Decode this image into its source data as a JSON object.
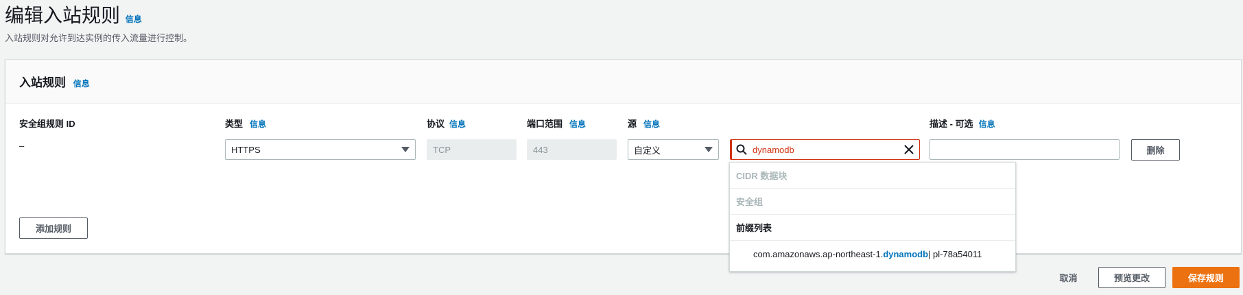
{
  "page": {
    "title": "编辑入站规则",
    "title_info": "信息",
    "subtitle": "入站规则对允许到达实例的传入流量进行控制。"
  },
  "panel": {
    "title": "入站规则",
    "title_info": "信息",
    "columns": {
      "rule_id": "安全组规则 ID",
      "type": "类型",
      "protocol": "协议",
      "port_range": "端口范围",
      "source": "源",
      "description": "描述 - 可选",
      "info": "信息"
    },
    "rule": {
      "rule_id": "–",
      "type": "HTTPS",
      "protocol": "TCP",
      "port_range": "443",
      "source_mode": "自定义",
      "search_value": "dynamodb",
      "description": ""
    },
    "delete_label": "删除",
    "add_rule_label": "添加规则"
  },
  "dropdown": {
    "groups": [
      {
        "label": "CIDR 数据块",
        "enabled": false
      },
      {
        "label": "安全组",
        "enabled": false
      },
      {
        "label": "前缀列表",
        "enabled": true
      }
    ],
    "option": {
      "prefix": "com.amazonaws.ap-northeast-1.",
      "highlight": "dynamodb",
      "suffix": " | pl-78a54011"
    }
  },
  "footer": {
    "cancel_label": "取消",
    "preview_label": "预览更改",
    "save_label": "保存规则"
  },
  "colors": {
    "primary": "#ec7211",
    "link": "#0073bb",
    "error": "#d13212"
  }
}
